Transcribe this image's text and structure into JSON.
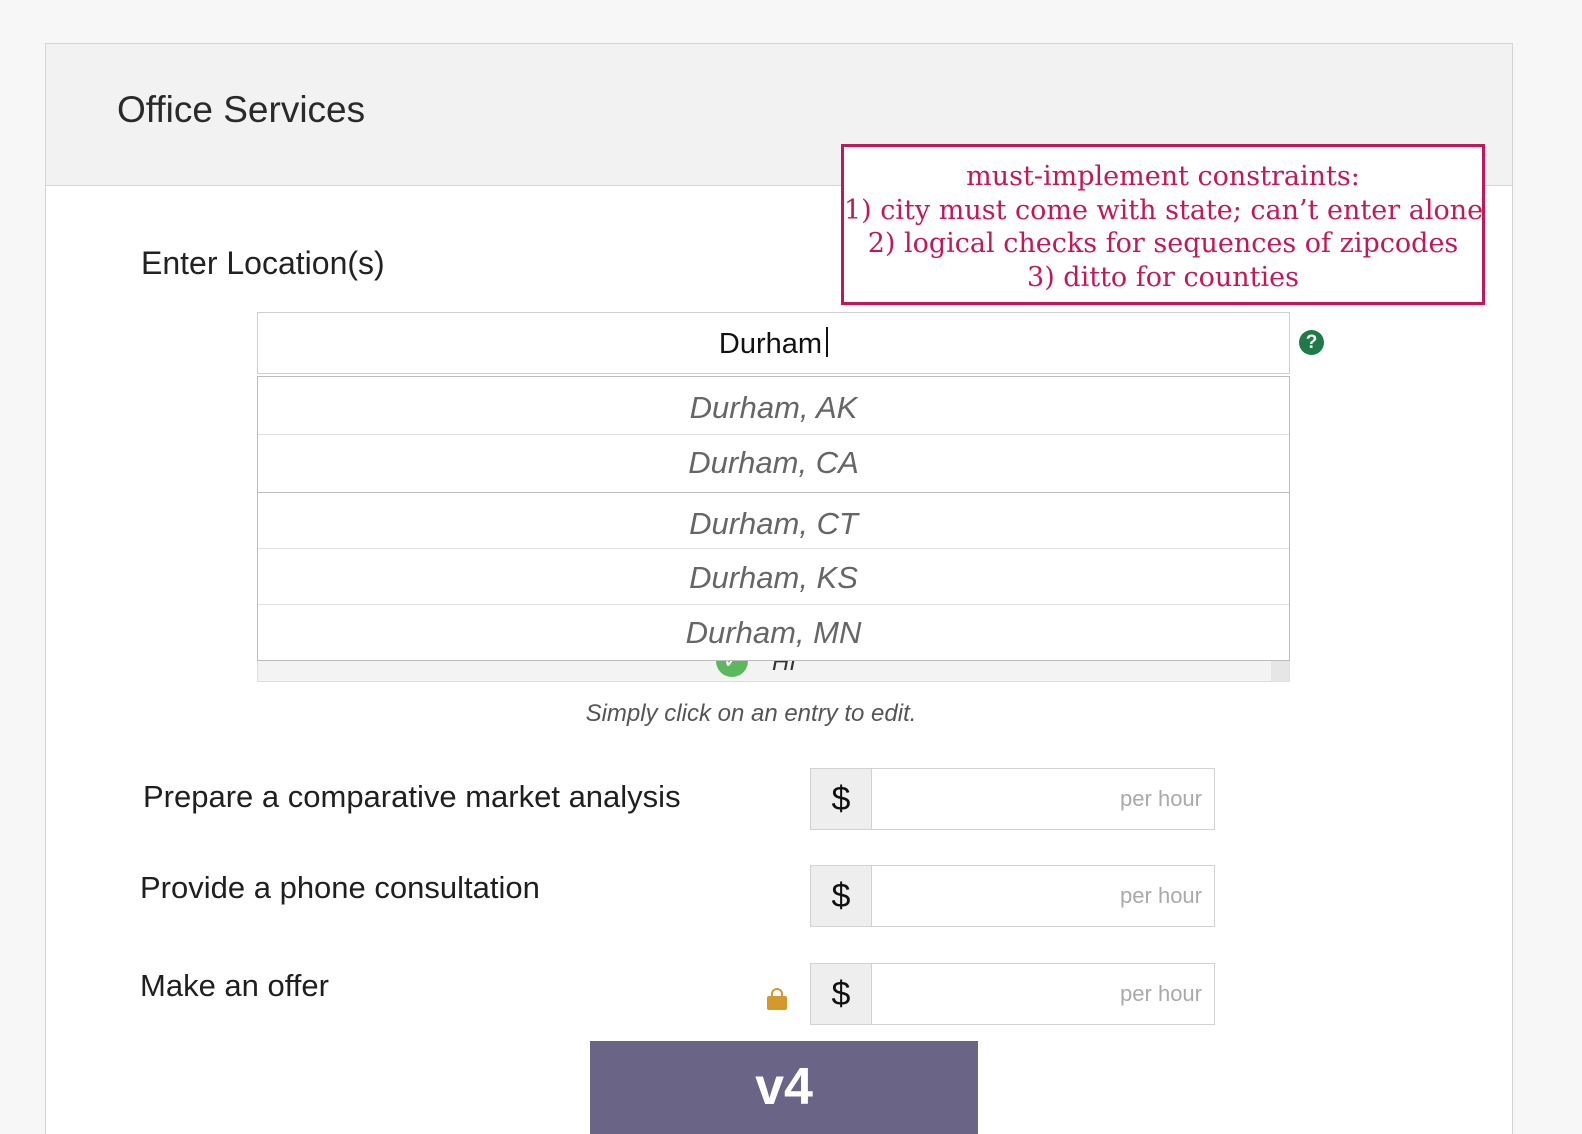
{
  "header": {
    "title": "Office Services"
  },
  "annotation": {
    "lines": [
      "must-implement constraints:",
      "1) city must come with state; can’t enter alone",
      "2) logical checks for sequences of zipcodes",
      "3) ditto for counties"
    ],
    "color": "#c2185b"
  },
  "location": {
    "label": "Enter Location(s)",
    "input_value": "Durham",
    "help_icon": "?",
    "suggestions": [
      "Durham, AK",
      "Durham, CA",
      "Durham, CT",
      "Durham, KS",
      "Durham, MN"
    ],
    "partial_entry": "HI",
    "helper_text": "Simply click on an entry to edit."
  },
  "services": [
    {
      "label": "Prepare a comparative market analysis",
      "currency": "$",
      "placeholder": "per hour"
    },
    {
      "label": "Provide a phone consultation",
      "currency": "$",
      "placeholder": "per hour"
    },
    {
      "label": "Make an offer",
      "currency": "$",
      "placeholder": "per hour"
    }
  ],
  "banner": {
    "text": "v4",
    "color": "#6a6487"
  }
}
